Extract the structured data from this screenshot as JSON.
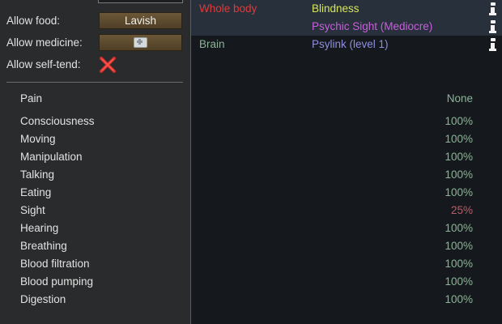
{
  "settings": {
    "food_label": "Allow food:",
    "food_value": "Lavish",
    "medicine_label": "Allow medicine:",
    "selftend_label": "Allow self-tend:"
  },
  "capacities": [
    {
      "label": "Pain",
      "value": "None"
    },
    {
      "label": "Consciousness",
      "value": "100%"
    },
    {
      "label": "Moving",
      "value": "100%"
    },
    {
      "label": "Manipulation",
      "value": "100%"
    },
    {
      "label": "Talking",
      "value": "100%"
    },
    {
      "label": "Eating",
      "value": "100%"
    },
    {
      "label": "Sight",
      "value": "25%"
    },
    {
      "label": "Hearing",
      "value": "100%"
    },
    {
      "label": "Breathing",
      "value": "100%"
    },
    {
      "label": "Blood filtration",
      "value": "100%"
    },
    {
      "label": "Blood pumping",
      "value": "100%"
    },
    {
      "label": "Digestion",
      "value": "100%"
    }
  ],
  "health": {
    "rows": [
      {
        "part": "Whole body",
        "conditions": [
          "Blindness",
          "Psychic Sight (Mediocre)"
        ]
      },
      {
        "part": "Brain",
        "conditions": [
          "Psylink (level 1)"
        ]
      }
    ]
  },
  "colors": {
    "part_whole_body": "#e03a3a",
    "part_brain": "#8cb497",
    "cond_blindness": "#d9e65a",
    "cond_psychic_sight": "#c75fdc",
    "cond_psylink": "#8f8fe0",
    "value_good": "#8cb497",
    "value_bad": "#b5606a"
  },
  "icons": {
    "medicine": "medicine-kit-icon",
    "selftend": "red-x-icon",
    "info": "info-icon"
  }
}
